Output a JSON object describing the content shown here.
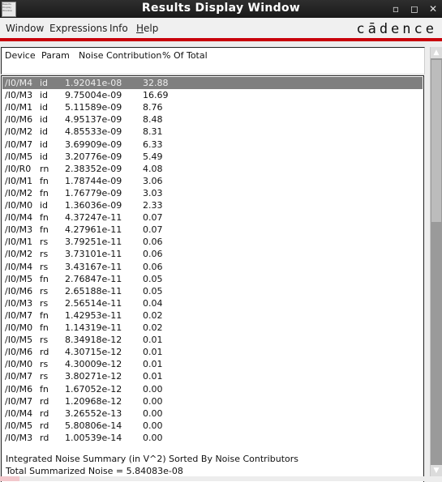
{
  "window": {
    "title": "Results Display Window",
    "app_icon_text": "Results Display Window",
    "minimize_icon": "minimize-icon",
    "maximize_icon": "maximize-icon",
    "close_icon": "close-icon"
  },
  "menubar": {
    "items": [
      {
        "label": "Window"
      },
      {
        "label": "Expressions"
      },
      {
        "label": "Info"
      },
      {
        "label": "Help",
        "mnemonic": "H"
      }
    ],
    "logo": "cādence"
  },
  "colors": {
    "accent_red": "#c8000a",
    "selected_row": "#7f7f7f",
    "titlebar": "#1f1f1f"
  },
  "table": {
    "headers": [
      "Device",
      "Param",
      "Noise Contribution",
      "% Of Total"
    ],
    "selected_index": 0,
    "rows": [
      {
        "device": "/I0/M4",
        "param": "id",
        "noise": "1.92041e-08",
        "pct": "32.88"
      },
      {
        "device": "/I0/M3",
        "param": "id",
        "noise": "9.75004e-09",
        "pct": "16.69"
      },
      {
        "device": "/I0/M1",
        "param": "id",
        "noise": "5.11589e-09",
        "pct": "8.76"
      },
      {
        "device": "/I0/M6",
        "param": "id",
        "noise": "4.95137e-09",
        "pct": "8.48"
      },
      {
        "device": "/I0/M2",
        "param": "id",
        "noise": "4.85533e-09",
        "pct": "8.31"
      },
      {
        "device": "/I0/M7",
        "param": "id",
        "noise": "3.69909e-09",
        "pct": "6.33"
      },
      {
        "device": "/I0/M5",
        "param": "id",
        "noise": "3.20776e-09",
        "pct": "5.49"
      },
      {
        "device": "/I0/R0",
        "param": "rn",
        "noise": "2.38352e-09",
        "pct": "4.08"
      },
      {
        "device": "/I0/M1",
        "param": "fn",
        "noise": "1.78744e-09",
        "pct": "3.06"
      },
      {
        "device": "/I0/M2",
        "param": "fn",
        "noise": "1.76779e-09",
        "pct": "3.03"
      },
      {
        "device": "/I0/M0",
        "param": "id",
        "noise": "1.36036e-09",
        "pct": "2.33"
      },
      {
        "device": "/I0/M4",
        "param": "fn",
        "noise": "4.37247e-11",
        "pct": "0.07"
      },
      {
        "device": "/I0/M3",
        "param": "fn",
        "noise": "4.27961e-11",
        "pct": "0.07"
      },
      {
        "device": "/I0/M1",
        "param": "rs",
        "noise": "3.79251e-11",
        "pct": "0.06"
      },
      {
        "device": "/I0/M2",
        "param": "rs",
        "noise": "3.73101e-11",
        "pct": "0.06"
      },
      {
        "device": "/I0/M4",
        "param": "rs",
        "noise": "3.43167e-11",
        "pct": "0.06"
      },
      {
        "device": "/I0/M5",
        "param": "fn",
        "noise": "2.76847e-11",
        "pct": "0.05"
      },
      {
        "device": "/I0/M6",
        "param": "rs",
        "noise": "2.65188e-11",
        "pct": "0.05"
      },
      {
        "device": "/I0/M3",
        "param": "rs",
        "noise": "2.56514e-11",
        "pct": "0.04"
      },
      {
        "device": "/I0/M7",
        "param": "fn",
        "noise": "1.42953e-11",
        "pct": "0.02"
      },
      {
        "device": "/I0/M0",
        "param": "fn",
        "noise": "1.14319e-11",
        "pct": "0.02"
      },
      {
        "device": "/I0/M5",
        "param": "rs",
        "noise": "8.34918e-12",
        "pct": "0.01"
      },
      {
        "device": "/I0/M6",
        "param": "rd",
        "noise": "4.30715e-12",
        "pct": "0.01"
      },
      {
        "device": "/I0/M0",
        "param": "rs",
        "noise": "4.30009e-12",
        "pct": "0.01"
      },
      {
        "device": "/I0/M7",
        "param": "rs",
        "noise": "3.80271e-12",
        "pct": "0.01"
      },
      {
        "device": "/I0/M6",
        "param": "fn",
        "noise": "1.67052e-12",
        "pct": "0.00"
      },
      {
        "device": "/I0/M7",
        "param": "rd",
        "noise": "1.20968e-12",
        "pct": "0.00"
      },
      {
        "device": "/I0/M4",
        "param": "rd",
        "noise": "3.26552e-13",
        "pct": "0.00"
      },
      {
        "device": "/I0/M5",
        "param": "rd",
        "noise": "5.80806e-14",
        "pct": "0.00"
      },
      {
        "device": "/I0/M3",
        "param": "rd",
        "noise": "1.00539e-14",
        "pct": "0.00"
      }
    ]
  },
  "summary": {
    "line1": "Integrated Noise Summary (in V^2) Sorted By Noise Contributors",
    "line2": "Total Summarized Noise = 5.84083e-08"
  },
  "scrollbar": {
    "up_icon": "▲",
    "down_icon": "▼"
  }
}
